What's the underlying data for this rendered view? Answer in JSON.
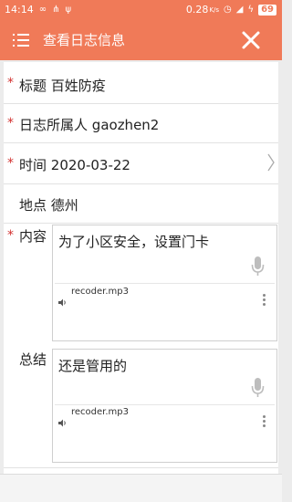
{
  "status_bar": {
    "time": "14:14",
    "network_speed": "0.28",
    "speed_unit": "K/s",
    "battery_level": "69"
  },
  "app_bar": {
    "title": "查看日志信息"
  },
  "form": {
    "required_mark": "*",
    "title_label": "标题",
    "title_value": "百姓防疫",
    "owner_label": "日志所属人",
    "owner_value": "gaozhen2",
    "time_label": "时间",
    "time_value": "2020-03-22",
    "location_label": "地点",
    "location_value": "德州",
    "content_label": "内容",
    "content_value": "为了小区安全，设置门卡",
    "content_attachment": "recoder.mp3",
    "summary_label": "总结",
    "summary_value": "还是管用的",
    "summary_attachment": "recoder.mp3"
  },
  "colors": {
    "accent": "#f07a58",
    "required": "#d2302f"
  },
  "icons": [
    "menu-icon",
    "close-icon",
    "chevron-right-icon",
    "microphone-icon",
    "speaker-icon",
    "more-vertical-icon"
  ]
}
